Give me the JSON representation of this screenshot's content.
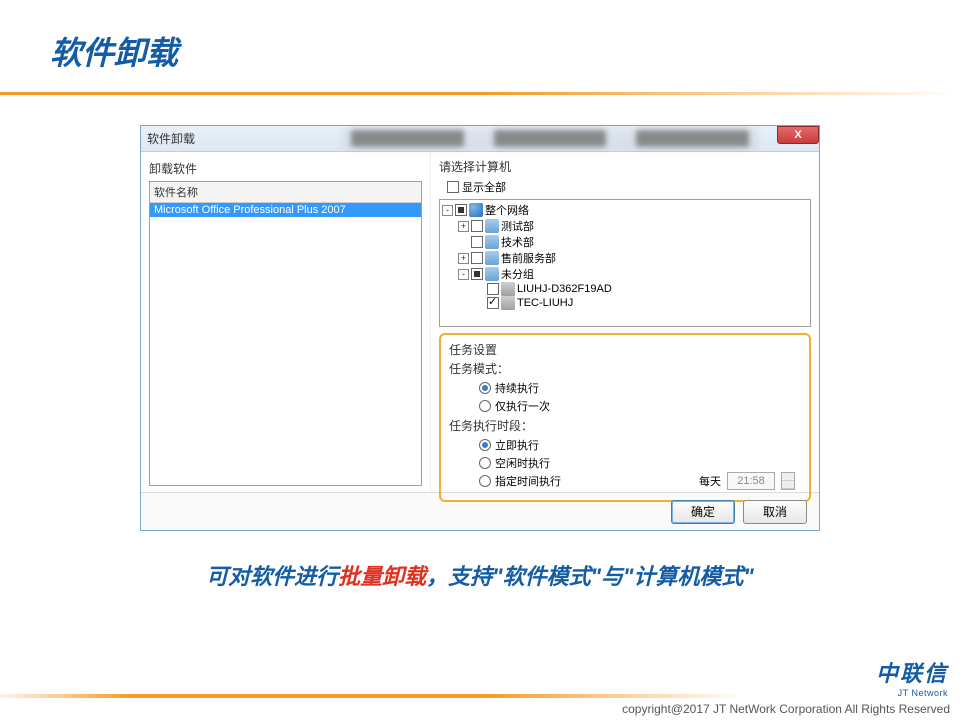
{
  "slide": {
    "title": "软件卸载",
    "caption_prefix": "可对软件进行",
    "caption_red": "批量卸载",
    "caption_suffix": "，支持\"软件模式\"与\"计算机模式\""
  },
  "window": {
    "title": "软件卸载",
    "close": "X"
  },
  "left": {
    "group_label": "卸载软件",
    "header": "软件名称",
    "items": [
      "Microsoft Office Professional Plus 2007"
    ]
  },
  "right": {
    "select_pc_label": "请选择计算机",
    "show_all": "显示全部",
    "tree": {
      "root": "整个网络",
      "groups": [
        "测试部",
        "技术部",
        "售前服务部",
        "未分组"
      ],
      "pcs": [
        "LIUHJ-D362F19AD",
        "TEC-LIUHJ"
      ]
    }
  },
  "task": {
    "title": "任务设置",
    "mode_label": "任务模式：",
    "mode_options": [
      "持续执行",
      "仅执行一次"
    ],
    "period_label": "任务执行时段：",
    "period_options": [
      "立即执行",
      "空闲时执行",
      "指定时间执行"
    ],
    "daily": "每天",
    "time_value": "21:58"
  },
  "buttons": {
    "ok": "确定",
    "cancel": "取消"
  },
  "footer": {
    "logo": "中联信",
    "logo_sub": "JT Network",
    "copyright": "copyright@2017  JT NetWork Corporation All Rights Reserved"
  }
}
